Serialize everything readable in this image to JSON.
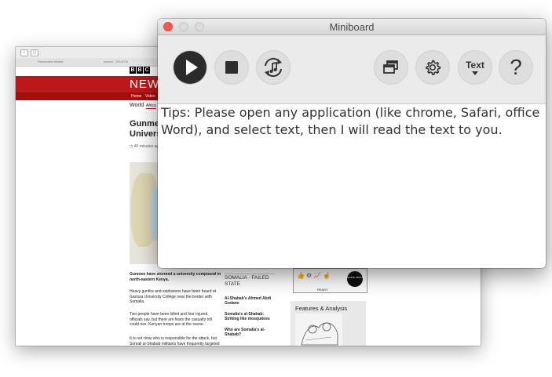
{
  "miniboard": {
    "window_title": "Miniboard",
    "toolbar": {
      "play_icon": "play-icon",
      "stop_icon": "stop-icon",
      "repeat_icon": "repeat-music-icon",
      "windows_icon": "windows-icon",
      "settings_icon": "gear-icon",
      "text_label": "Text",
      "help_label": "?"
    },
    "text_content": "Tips: Please open any application (like chrome, Safari, office Word), and select text, then I will read the text to you."
  },
  "browser_background": {
    "tabs": [
      "Resizeable Mobile",
      "search : 2014/7/6"
    ],
    "bbc_logo": [
      "B",
      "B",
      "C"
    ],
    "news_word": "NEWS",
    "nav_items": [
      "Home",
      "Video"
    ],
    "section": "World",
    "section_active": "Africa",
    "headline_lines": [
      "Gunmen",
      "Univers"
    ],
    "timestamp": "40 minutes ago",
    "article_paragraphs": [
      "Gunmen have stormed a university compound in north-eastern Kenya.",
      "Heavy gunfire and explosions have been heard at Garissa University College near the border with Somalia.",
      "Two people have been killed and four injured, officials say, but there are fears the casualty toll could rise. Kenyan troops are at the scene.",
      "It is not clear who is responsible for the attack, but Somali al-Shabab militants have frequently targeted"
    ],
    "sidebar": {
      "heading": "SOMALIA - FAILED STATE",
      "links": [
        "Al-Shabab's Ahmed Abdi Godane",
        "Somalia's al-Shabab: Striking like mosquitoes",
        "Who are Somalia's al-Shabab?"
      ]
    },
    "ad": {
      "logo_text": "icons mind",
      "ready_text": "READY"
    },
    "features_title": "Features & Analysis"
  },
  "colors": {
    "bbc_red": "#bb1919",
    "close_button": "#fc5753",
    "toolbar_bg": "#ebebeb"
  }
}
